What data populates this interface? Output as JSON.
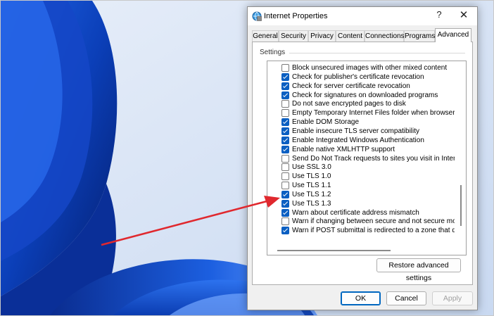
{
  "colors": {
    "accent": "#0a5fc2",
    "arrow": "#e0282e",
    "wallpaper_blue": "#0b3fb8"
  },
  "dialog": {
    "title": "Internet Properties",
    "icon": "internet-options-icon",
    "help_label": "?",
    "close_label": "✕"
  },
  "tabs": [
    {
      "label": "General",
      "active": false
    },
    {
      "label": "Security",
      "active": false
    },
    {
      "label": "Privacy",
      "active": false
    },
    {
      "label": "Content",
      "active": false
    },
    {
      "label": "Connections",
      "active": false
    },
    {
      "label": "Programs",
      "active": false
    },
    {
      "label": "Advanced",
      "active": true
    }
  ],
  "settings": {
    "group_label": "Settings",
    "items": [
      {
        "label": "Block unsecured images with other mixed content",
        "checked": false
      },
      {
        "label": "Check for publisher's certificate revocation",
        "checked": true
      },
      {
        "label": "Check for server certificate revocation",
        "checked": true
      },
      {
        "label": "Check for signatures on downloaded programs",
        "checked": true
      },
      {
        "label": "Do not save encrypted pages to disk",
        "checked": false
      },
      {
        "label": "Empty Temporary Internet Files folder when browser is clo",
        "checked": false
      },
      {
        "label": "Enable DOM Storage",
        "checked": true
      },
      {
        "label": "Enable insecure TLS server compatibility",
        "checked": true
      },
      {
        "label": "Enable Integrated Windows Authentication",
        "checked": true
      },
      {
        "label": "Enable native XMLHTTP support",
        "checked": true
      },
      {
        "label": "Send Do Not Track requests to sites you visit in Internet E",
        "checked": false
      },
      {
        "label": "Use SSL 3.0",
        "checked": false
      },
      {
        "label": "Use TLS 1.0",
        "checked": false
      },
      {
        "label": "Use TLS 1.1",
        "checked": false
      },
      {
        "label": "Use TLS 1.2",
        "checked": true
      },
      {
        "label": "Use TLS 1.3",
        "checked": true
      },
      {
        "label": "Warn about certificate address mismatch",
        "checked": true
      },
      {
        "label": "Warn if changing between secure and not secure mode",
        "checked": false
      },
      {
        "label": "Warn if POST submittal is redirected to a zone that does n",
        "checked": true
      }
    ]
  },
  "buttons": {
    "restore": "Restore advanced settings",
    "ok": "OK",
    "cancel": "Cancel",
    "apply": "Apply"
  }
}
